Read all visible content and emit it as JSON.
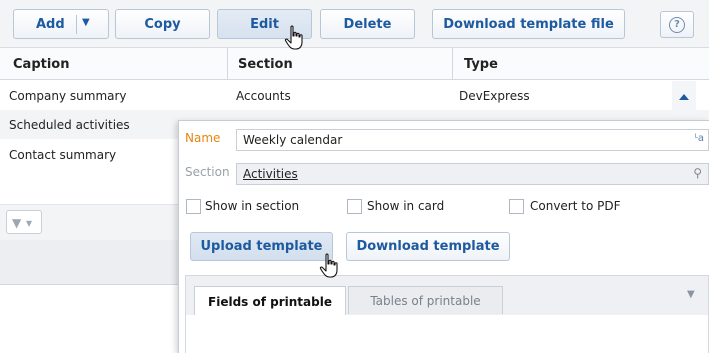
{
  "toolbar": {
    "add_label": "Add",
    "copy_label": "Copy",
    "edit_label": "Edit",
    "delete_label": "Delete",
    "download_template_file_label": "Download template file",
    "help_icon": "?"
  },
  "grid": {
    "columns": [
      "Caption",
      "Section",
      "Type"
    ],
    "rows": [
      {
        "caption": "Company summary",
        "section": "Accounts",
        "type": "DevExpress"
      },
      {
        "caption": "Scheduled activities"
      },
      {
        "caption": "Contact summary"
      }
    ]
  },
  "panel": {
    "name_label": "Name",
    "name_value": "Weekly calendar",
    "section_label": "Section",
    "section_value": "Activities",
    "checkboxes": [
      "Show in section",
      "Show in card",
      "Convert to PDF"
    ],
    "upload_template_label": "Upload template",
    "download_template_label": "Download template",
    "tabs": [
      "Fields of printable",
      "Tables of printable"
    ]
  },
  "colors": {
    "accent": "#1d5a9f",
    "name_label": "#e8850f"
  }
}
